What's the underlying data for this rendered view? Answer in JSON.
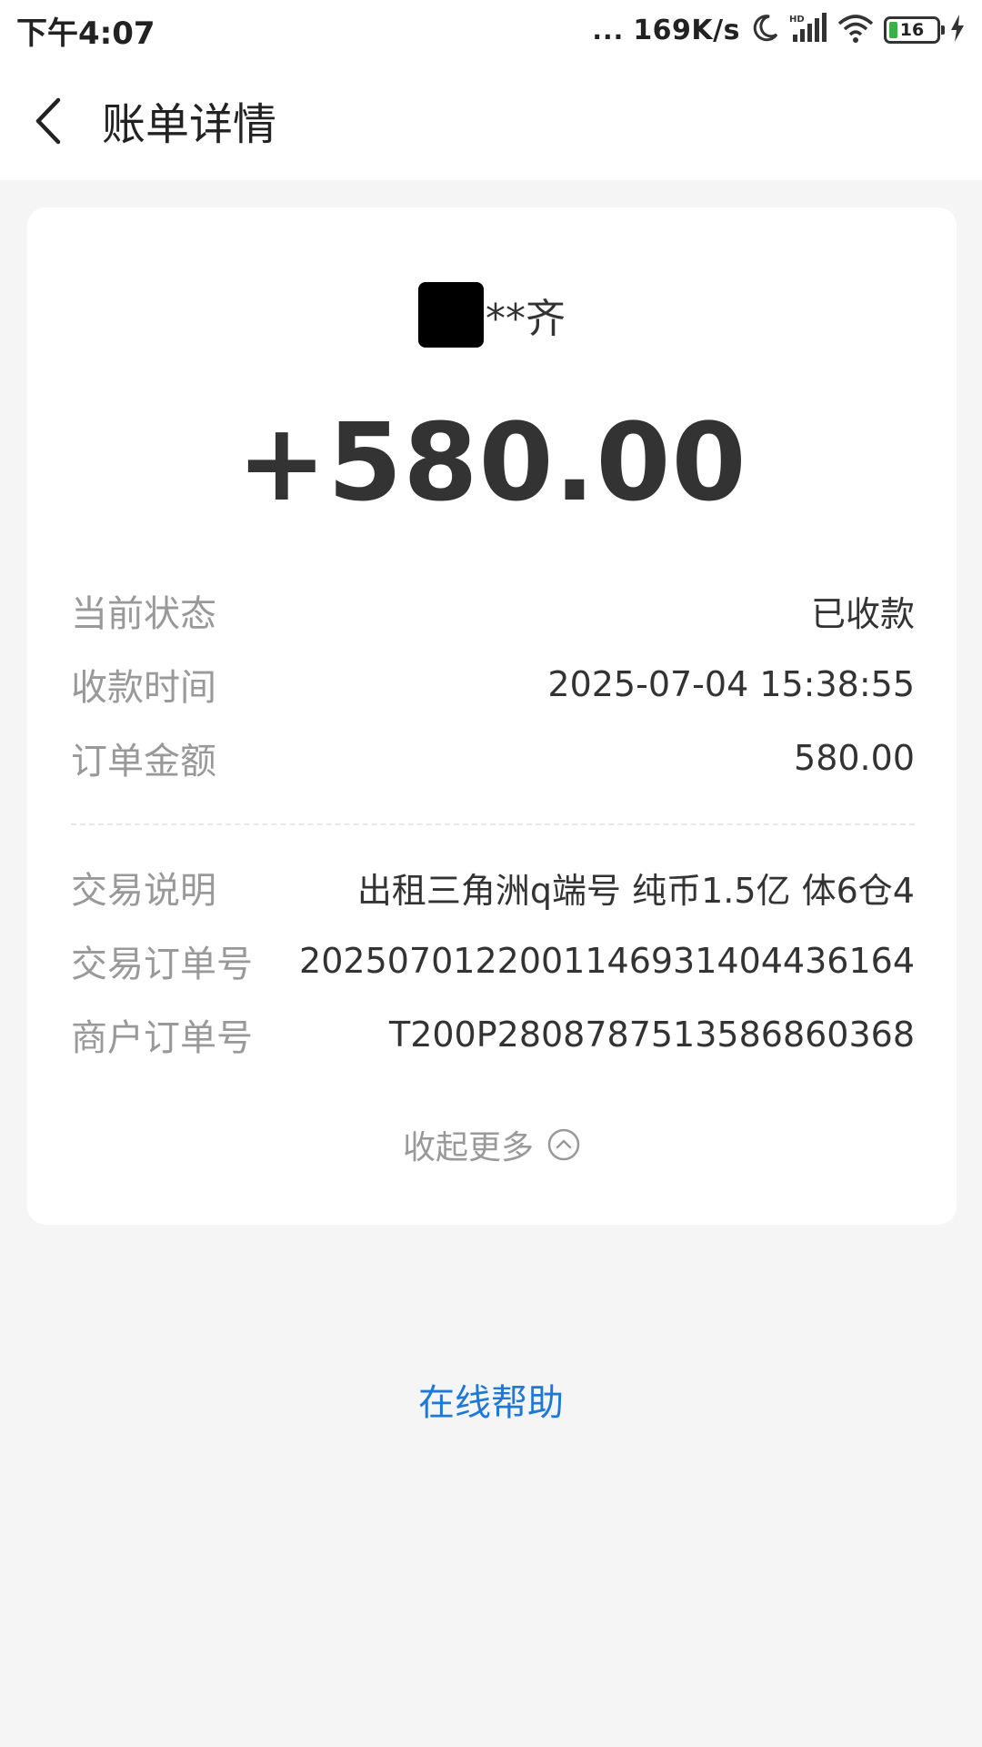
{
  "status_bar": {
    "time": "下午4:07",
    "dots": "...",
    "net_speed": "169K/s",
    "battery_level": "16"
  },
  "header": {
    "title": "账单详情"
  },
  "bill": {
    "payer_name": "**齐",
    "amount": "+580.00",
    "rows_top": [
      {
        "label": "当前状态",
        "value": "已收款"
      },
      {
        "label": "收款时间",
        "value": "2025-07-04 15:38:55"
      },
      {
        "label": "订单金额",
        "value": "580.00"
      }
    ],
    "rows_bottom": [
      {
        "label": "交易说明",
        "value": "出租三角洲q端号 纯币1.5亿 体6仓4"
      },
      {
        "label": "交易订单号",
        "value": "2025070122001146931404436164"
      },
      {
        "label": "商户订单号",
        "value": "T200P2808787513586860368"
      }
    ],
    "collapse_label": "收起更多"
  },
  "footer": {
    "help_label": "在线帮助"
  },
  "colors": {
    "accent": "#1e78d7",
    "label_gray": "#999999",
    "text_dark": "#333333",
    "page_bg": "#f5f5f5"
  }
}
